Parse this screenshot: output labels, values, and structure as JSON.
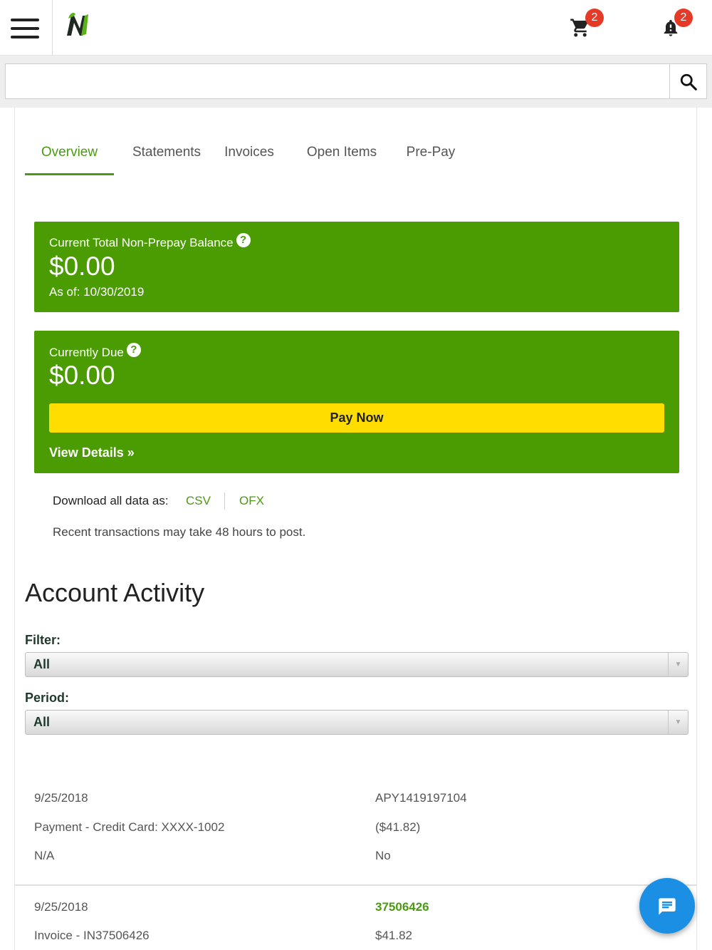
{
  "header": {
    "menu_icon": "hamburger-menu-icon",
    "logo_icon": "brand-logo-n",
    "cart": {
      "icon": "shopping-cart-icon",
      "badge": "2"
    },
    "notifications": {
      "icon": "bell-icon",
      "badge": "2"
    }
  },
  "search": {
    "value": "",
    "placeholder": "",
    "icon": "search-icon"
  },
  "tabs": [
    {
      "label": "Overview",
      "active": true
    },
    {
      "label": "Statements",
      "active": false
    },
    {
      "label": "Invoices",
      "active": false
    },
    {
      "label": "Open Items",
      "active": false
    },
    {
      "label": "Pre-Pay",
      "active": false
    }
  ],
  "balance_card": {
    "label": "Current Total Non-Prepay Balance",
    "amount": "$0.00",
    "as_of": "As of: 10/30/2019"
  },
  "due_card": {
    "label": "Currently Due",
    "amount": "$0.00",
    "pay_button": "Pay Now",
    "view_details": "View Details »"
  },
  "download": {
    "label": "Download all data as:",
    "csv": "CSV",
    "ofx": "OFX"
  },
  "notice": "Recent transactions may take 48 hours to post.",
  "activity": {
    "title": "Account Activity",
    "filter_label": "Filter:",
    "filter_value": "All",
    "period_label": "Period:",
    "period_value": "All"
  },
  "transactions": [
    {
      "date": "9/25/2018",
      "reference": "APY1419197104",
      "description": "Payment - Credit Card: XXXX-1002",
      "amount": "($41.82)",
      "col5": "N/A",
      "col6": "No"
    },
    {
      "date": "9/25/2018",
      "reference": "37506426",
      "description": "Invoice - IN37506426",
      "amount": "$41.82"
    }
  ],
  "colors": {
    "brand_green": "#4a9c02",
    "link_green": "#4a9a12",
    "pay_yellow": "#ffdd00",
    "badge_red": "#e53a28",
    "chat_blue": "#1a8fe3"
  },
  "chat": {
    "icon": "chat-message-icon"
  }
}
